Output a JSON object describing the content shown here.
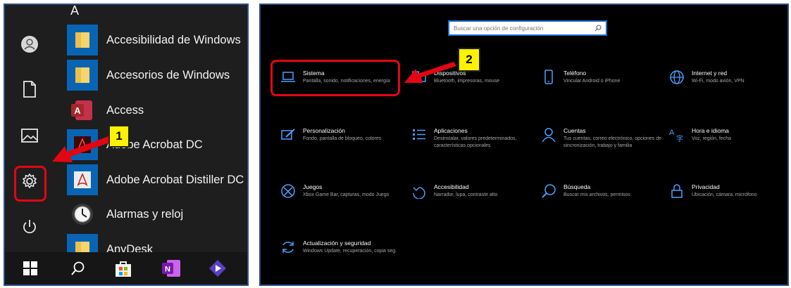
{
  "start_menu": {
    "letter_header": "A",
    "apps": [
      {
        "label": "Accesibilidad de Windows",
        "icon": "folder-icon"
      },
      {
        "label": "Accesorios de Windows",
        "icon": "folder-icon"
      },
      {
        "label": "Access",
        "icon": "access-icon"
      },
      {
        "label": "Adobe Acrobat DC",
        "icon": "acrobat-icon"
      },
      {
        "label": "Adobe Acrobat Distiller DC",
        "icon": "distiller-icon"
      },
      {
        "label": "Alarmas y reloj",
        "icon": "alarm-clock-icon"
      },
      {
        "label": "AnyDesk",
        "icon": "folder-icon"
      }
    ],
    "rail_icons": [
      "user-avatar-icon",
      "document-icon",
      "pictures-icon",
      "settings-gear-icon",
      "power-icon"
    ],
    "taskbar_icons": [
      "windows-start-icon",
      "search-icon",
      "store-icon",
      "onenote-icon",
      "media-player-icon"
    ]
  },
  "settings": {
    "search_placeholder": "Buscar una opción de configuración",
    "tiles": [
      {
        "title": "Sistema",
        "desc": "Pantalla, sonido, notificaciones, energía",
        "icon": "laptop-icon"
      },
      {
        "title": "Dispositivos",
        "desc": "Bluetooth, impresoras, mouse",
        "icon": "devices-icon"
      },
      {
        "title": "Teléfono",
        "desc": "Vincular Android o iPhone",
        "icon": "phone-icon"
      },
      {
        "title": "Internet y red",
        "desc": "Wi-Fi, modo avión, VPN",
        "icon": "globe-icon"
      },
      {
        "title": "Personalización",
        "desc": "Fondo, pantalla de bloqueo, colores",
        "icon": "paint-icon"
      },
      {
        "title": "Aplicaciones",
        "desc": "Desinstalar, valores predeterminados, características opcionales",
        "icon": "apps-list-icon"
      },
      {
        "title": "Cuentas",
        "desc": "Tus cuentas, correo electrónico, opciones de sincronización, trabajo y familia",
        "icon": "person-icon"
      },
      {
        "title": "Hora e idioma",
        "desc": "Voz, región, fecha",
        "icon": "time-language-icon"
      },
      {
        "title": "Juegos",
        "desc": "Xbox Game Bar, capturas, modo Juego",
        "icon": "xbox-icon"
      },
      {
        "title": "Accesibilidad",
        "desc": "Narrador, lupa, contraste alto",
        "icon": "accessibility-icon"
      },
      {
        "title": "Búsqueda",
        "desc": "Buscar mis archivos, permisos",
        "icon": "search-icon"
      },
      {
        "title": "Privacidad",
        "desc": "Ubicación, cámara, micrófono",
        "icon": "lock-icon"
      },
      {
        "title": "Actualización y seguridad",
        "desc": "Windows Update, recuperación, copia seg.",
        "icon": "update-icon"
      }
    ]
  },
  "annotations": {
    "badge_1": "1",
    "badge_2": "2",
    "highlight_color": "#e30613",
    "badge_color": "#fff200"
  },
  "colors": {
    "accent_blue": "#0a64b4",
    "settings_icon_blue": "#4aa0ff"
  }
}
